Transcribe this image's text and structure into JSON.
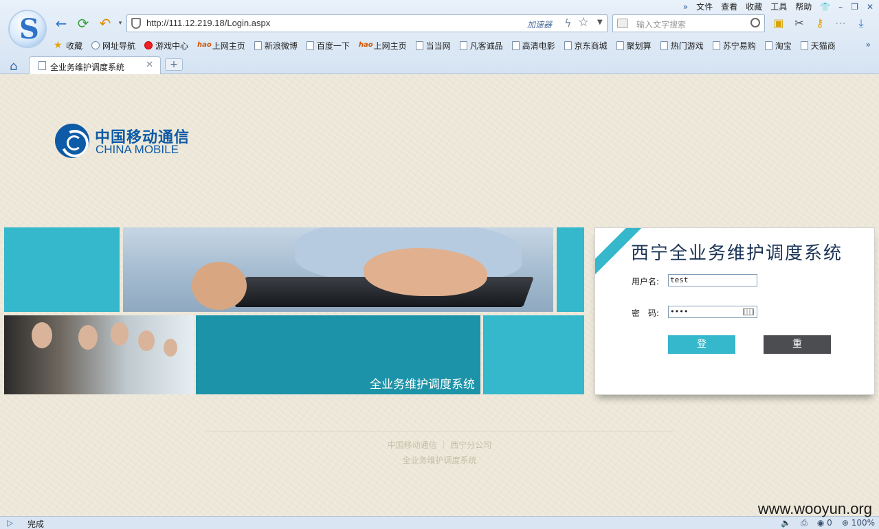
{
  "browser": {
    "menu": [
      "文件",
      "查看",
      "收藏",
      "工具",
      "帮助"
    ],
    "address": "http://111.12.219.18/Login.aspx",
    "accelerator_label": "加速器",
    "search_placeholder": "输入文字搜索",
    "favorites": [
      {
        "label": "收藏",
        "icon": "star-icon"
      },
      {
        "label": "网址导航",
        "icon": "globe-icon"
      },
      {
        "label": "游戏中心",
        "icon": "game-icon"
      },
      {
        "label": "上网主页",
        "icon": "hao-icon"
      },
      {
        "label": "新浪微博",
        "icon": "page-icon"
      },
      {
        "label": "百度一下",
        "icon": "page-icon"
      },
      {
        "label": "上网主页",
        "icon": "hao-icon"
      },
      {
        "label": "当当网",
        "icon": "page-icon"
      },
      {
        "label": "凡客诚品",
        "icon": "page-icon"
      },
      {
        "label": "高清电影",
        "icon": "page-icon"
      },
      {
        "label": "京东商城",
        "icon": "page-icon"
      },
      {
        "label": "聚划算",
        "icon": "page-icon"
      },
      {
        "label": "热门游戏",
        "icon": "page-icon"
      },
      {
        "label": "苏宁易购",
        "icon": "page-icon"
      },
      {
        "label": "淘宝",
        "icon": "page-icon"
      },
      {
        "label": "天猫商",
        "icon": "page-icon"
      }
    ],
    "tab_title": "全业务维护调度系统",
    "status_text": "完成",
    "status_right": {
      "count": "0",
      "zoom": "100%"
    },
    "watermark": "www.wooyun.org"
  },
  "page": {
    "logo_cn": "中国移动通信",
    "logo_en": "CHINA MOBILE",
    "banner_text": "全业务维护调度系统",
    "login": {
      "title": "西宁全业务维护调度系统",
      "username_label": "用户名:",
      "username_value": "test",
      "password_label": "密　码:",
      "password_value": "••••",
      "login_button": "登录",
      "reset_button": "重置"
    },
    "footer": {
      "line1": "中国移动通信 ｜ 西宁分公司",
      "line2": "全业务维护调度系统"
    }
  },
  "colors": {
    "accent_cyan": "#35b7cc",
    "accent_teal": "#1c93a8",
    "title_navy": "#1c3557",
    "brand_blue": "#0d5aa6",
    "reset_gray": "#4b4d51"
  }
}
